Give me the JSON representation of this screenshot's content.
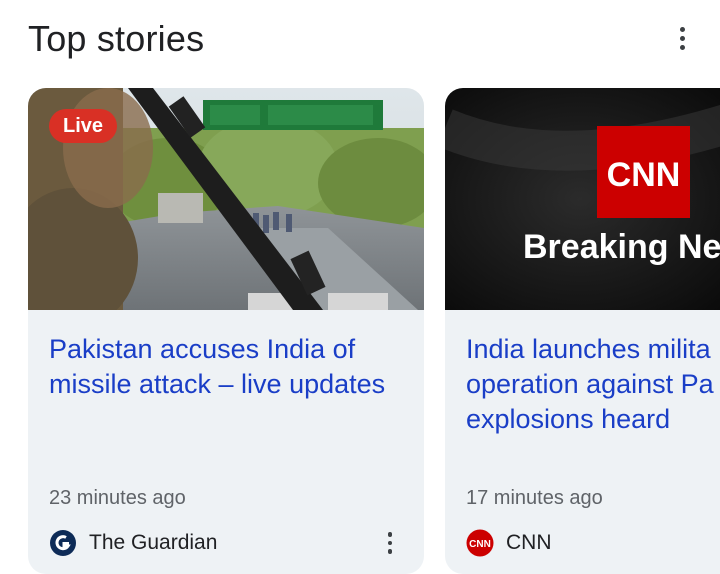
{
  "header": {
    "title": "Top stories",
    "menu_icon": "more-vert-icon"
  },
  "cards": [
    {
      "badge": "Live",
      "headline": "Pakistan accuses India of missile attack – live updates",
      "time": "23 minutes ago",
      "source": "The Guardian",
      "source_logo": "guardian-logo",
      "menu_icon": "more-vert-icon"
    },
    {
      "image_text_logo": "CNN",
      "image_text": "Breaking Ne",
      "headline_lines": [
        "India launches milita",
        "operation against Pa",
        "explosions heard"
      ],
      "time": "17 minutes ago",
      "source": "CNN",
      "source_logo": "cnn-logo"
    }
  ],
  "colors": {
    "headline": "#1a3ec7",
    "live_badge": "#d93025",
    "card_bg": "#eef2f5",
    "cnn_red": "#cc0000"
  }
}
